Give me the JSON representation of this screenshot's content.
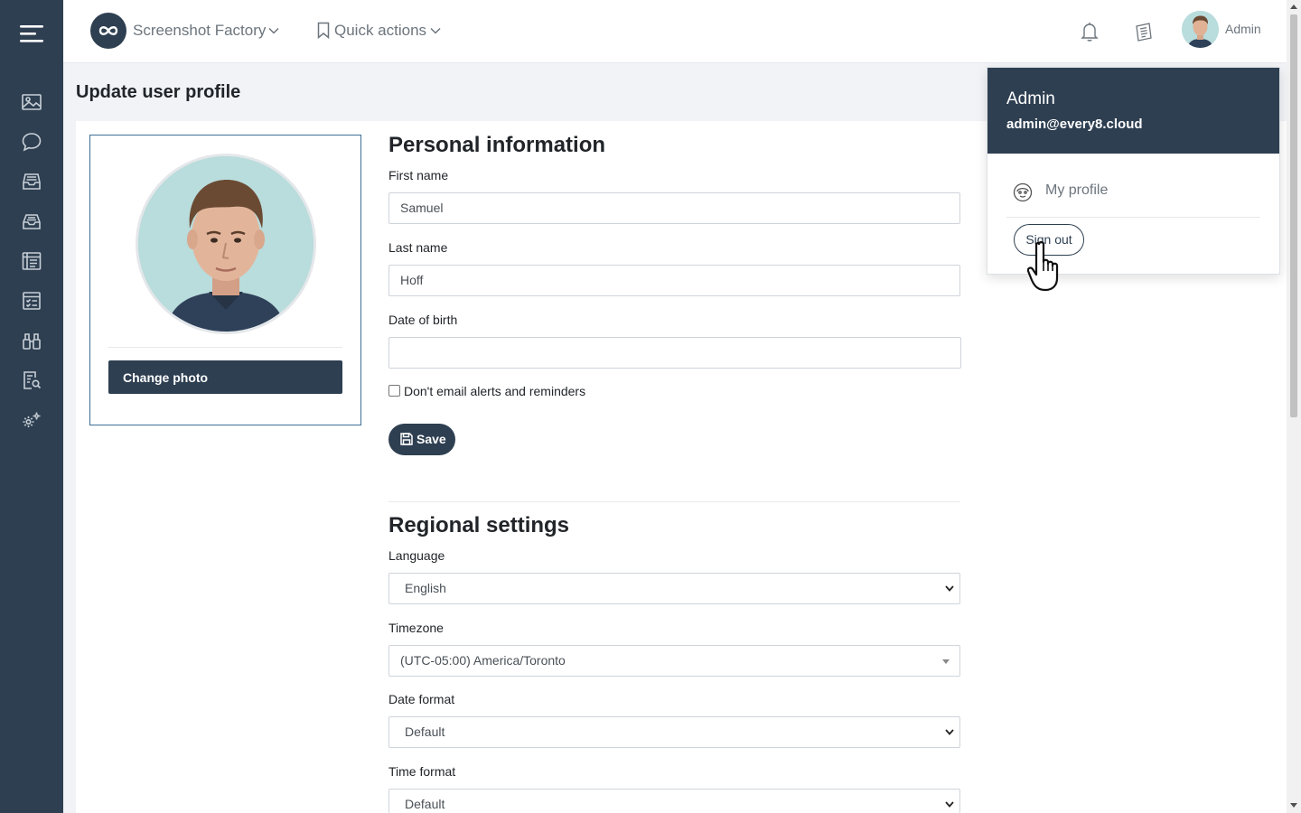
{
  "app": {
    "brand_name": "Screenshot Factory",
    "quick_actions_label": "Quick actions",
    "user_label": "Admin"
  },
  "sidebar": {
    "items": [
      {
        "icon": "image-icon"
      },
      {
        "icon": "chat-icon"
      },
      {
        "icon": "inbox-icon"
      },
      {
        "icon": "inbox-open-icon"
      },
      {
        "icon": "list-icon"
      },
      {
        "icon": "checklist-icon"
      },
      {
        "icon": "binoculars-icon"
      },
      {
        "icon": "report-search-icon"
      },
      {
        "icon": "gears-icon"
      }
    ]
  },
  "page": {
    "title": "Update user profile"
  },
  "profile_photo": {
    "change_photo_label": "Change photo"
  },
  "personal": {
    "heading": "Personal information",
    "first_name_label": "First name",
    "first_name_value": "Samuel",
    "last_name_label": "Last name",
    "last_name_value": "Hoff",
    "dob_label": "Date of birth",
    "dob_value": "",
    "no_email_label": "Don't email alerts and reminders",
    "no_email_checked": false,
    "save_label": "Save"
  },
  "regional": {
    "heading": "Regional settings",
    "language_label": "Language",
    "language_value": "English",
    "timezone_label": "Timezone",
    "timezone_value": "(UTC-05:00) America/Toronto",
    "date_format_label": "Date format",
    "date_format_value": "Default",
    "time_format_label": "Time format",
    "time_format_value": "Default"
  },
  "user_menu": {
    "name": "Admin",
    "email": "admin@every8.cloud",
    "my_profile_label": "My profile",
    "sign_out_label": "Sign out"
  },
  "colors": {
    "sidebar_bg": "#2e3f51",
    "accent": "#2e3f51",
    "page_bg": "#f1f3f6"
  }
}
